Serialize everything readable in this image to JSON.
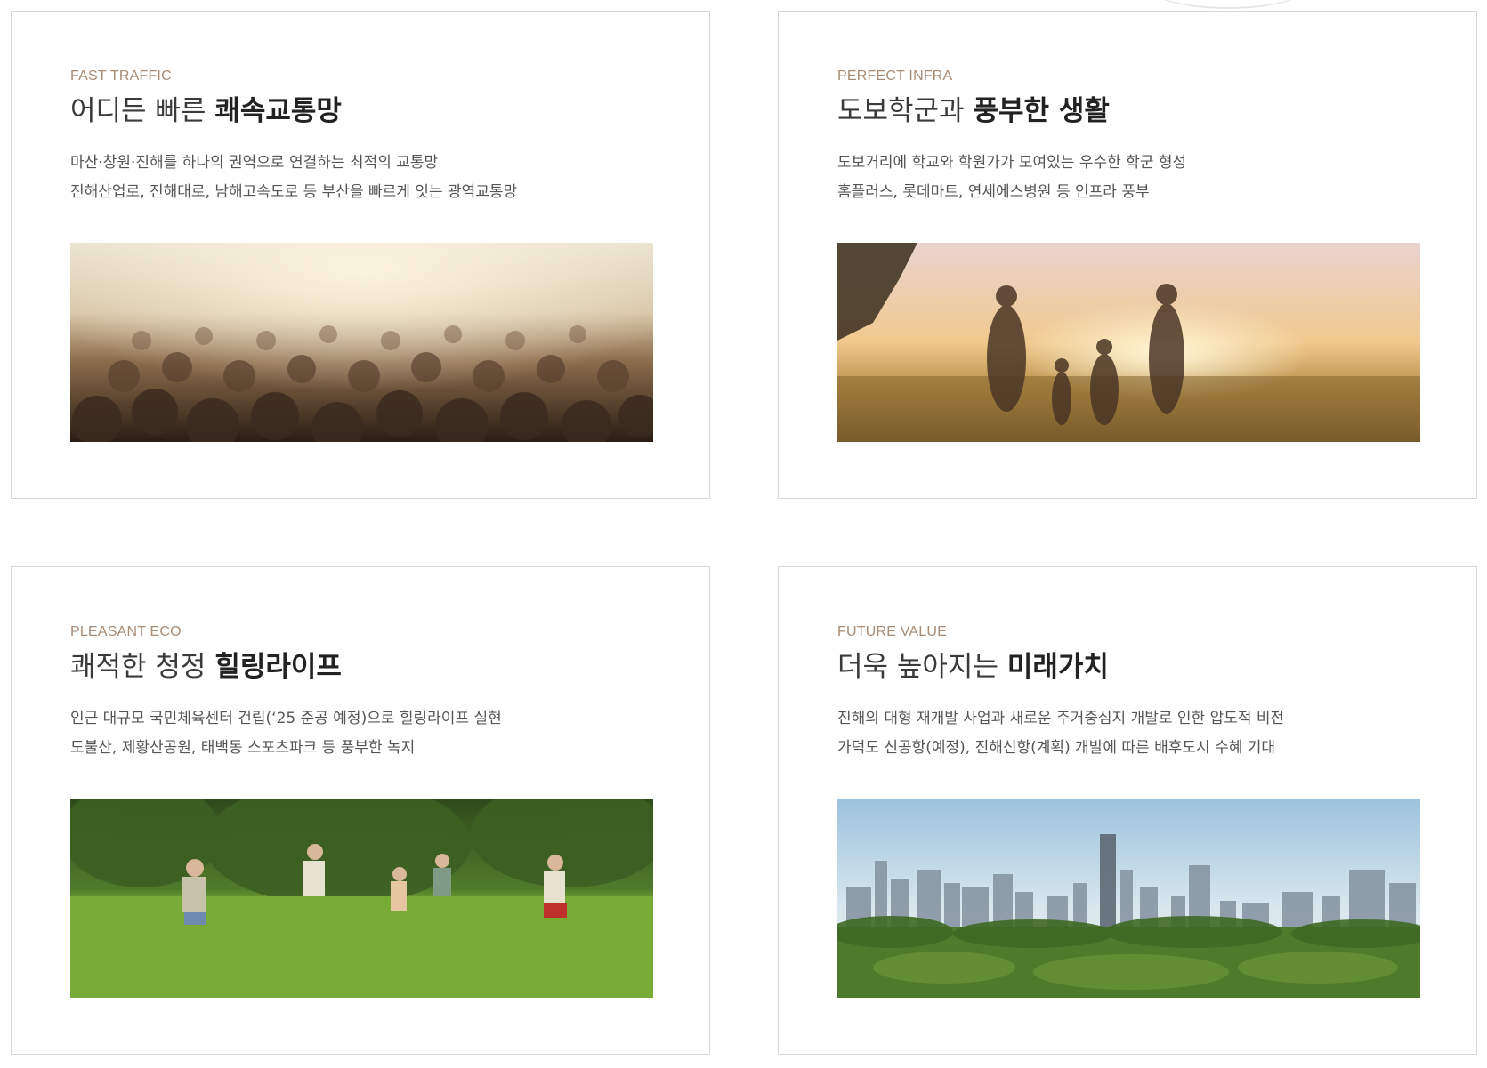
{
  "cards": [
    {
      "label": "FAST TRAFFIC",
      "title_light": "어디든 빠른 ",
      "title_bold": "쾌속교통망",
      "line1": "마산·창원·진해를 하나의 권역으로 연결하는 최적의 교통망",
      "line2": "진해산업로, 진해대로, 남해고속도로 등 부산을 빠르게 잇는 광역교통망",
      "image": "crowd-street-photo"
    },
    {
      "label": "PERFECT INFRA",
      "title_light": "도보학군과 ",
      "title_bold": "풍부한 생활",
      "line1": "도보거리에 학교와 학원가가 모여있는 우수한 학군 형성",
      "line2": "홈플러스, 롯데마트, 연세에스병원 등 인프라 풍부",
      "image": "family-sunset-field-photo"
    },
    {
      "label": "PLEASANT ECO",
      "title_light": "쾌적한 청정 ",
      "title_bold": "힐링라이프",
      "line1": "인근 대규모 국민체육센터 건립(‘25 준공 예정)으로 힐링라이프 실현",
      "line2": "도불산, 제황산공원, 태백동 스포츠파크 등 풍부한 녹지",
      "image": "children-park-photo"
    },
    {
      "label": "FUTURE VALUE",
      "title_light": "더욱 높아지는 ",
      "title_bold": "미래가치",
      "line1": "진해의 대형 재개발 사업과 새로운 주거중심지 개발로 인한 압도적 비전",
      "line2": "가덕도 신공항(예정), 진해신항(계획) 개발에 따른 배후도시 수혜 기대",
      "image": "city-skyline-forest-photo"
    }
  ]
}
